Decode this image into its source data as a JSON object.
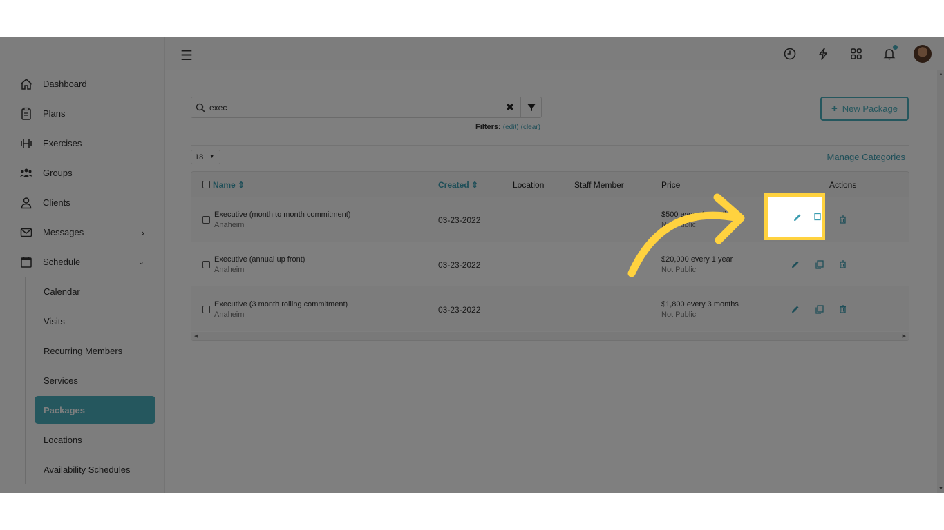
{
  "sidebar": {
    "items": [
      {
        "label": "Dashboard",
        "icon": "home-icon"
      },
      {
        "label": "Plans",
        "icon": "clipboard-icon"
      },
      {
        "label": "Exercises",
        "icon": "dumbbell-icon"
      },
      {
        "label": "Groups",
        "icon": "group-icon"
      },
      {
        "label": "Clients",
        "icon": "user-icon"
      },
      {
        "label": "Messages",
        "icon": "envelope-icon"
      },
      {
        "label": "Schedule",
        "icon": "calendar-icon"
      }
    ],
    "schedule_sub": [
      "Calendar",
      "Visits",
      "Recurring Members",
      "Services",
      "Packages",
      "Locations",
      "Availability Schedules"
    ]
  },
  "search": {
    "value": "exec",
    "clear": "✖"
  },
  "filters": {
    "label": "Filters:",
    "edit": "(edit)",
    "clear": "(clear)"
  },
  "new_package": {
    "plus": "+",
    "label": "New Package"
  },
  "per_page": "18",
  "manage_categories": "Manage Categories",
  "table": {
    "headers": {
      "name": "Name ⇕",
      "created": "Created ⇕",
      "location": "Location",
      "staff": "Staff Member",
      "price": "Price",
      "actions": "Actions"
    },
    "rows": [
      {
        "name": "Executive (month to month commitment)",
        "location": "Anaheim",
        "created": "03-23-2022",
        "price": "$500 every 1 month",
        "visibility": "Not Public"
      },
      {
        "name": "Executive (annual up front)",
        "location": "Anaheim",
        "created": "03-23-2022",
        "price": "$20,000 every 1 year",
        "visibility": "Not Public"
      },
      {
        "name": "Executive (3 month rolling commitment)",
        "location": "Anaheim",
        "created": "03-23-2022",
        "price": "$1,800 every 3 months",
        "visibility": "Not Public"
      }
    ]
  },
  "colors": {
    "accent": "#4aaebc",
    "highlight": "#ffd23f",
    "arrow": "#ffd23f"
  }
}
